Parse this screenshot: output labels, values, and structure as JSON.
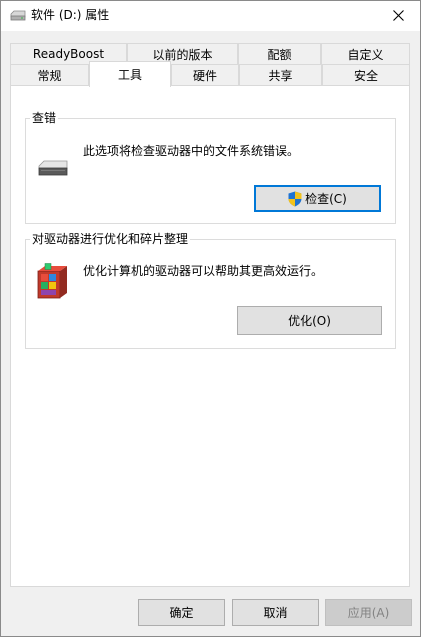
{
  "window": {
    "title": "软件 (D:) 属性"
  },
  "tabs_row1": [
    "ReadyBoost",
    "以前的版本",
    "配额",
    "自定义"
  ],
  "tabs_row2": [
    "常规",
    "工具",
    "硬件",
    "共享",
    "安全"
  ],
  "error_check": {
    "group_title": "查错",
    "description": "此选项将检查驱动器中的文件系统错误。",
    "button_label": "检查(C)"
  },
  "optimize": {
    "group_title": "对驱动器进行优化和碎片整理",
    "description": "优化计算机的驱动器可以帮助其更高效运行。",
    "button_label": "优化(O)"
  },
  "footer": {
    "ok_label": "确定",
    "cancel_label": "取消",
    "apply_label": "应用(A)"
  },
  "colors": {
    "accent": "#0078d7",
    "panel_bg": "#ffffff",
    "window_bg": "#f0f0f0"
  }
}
